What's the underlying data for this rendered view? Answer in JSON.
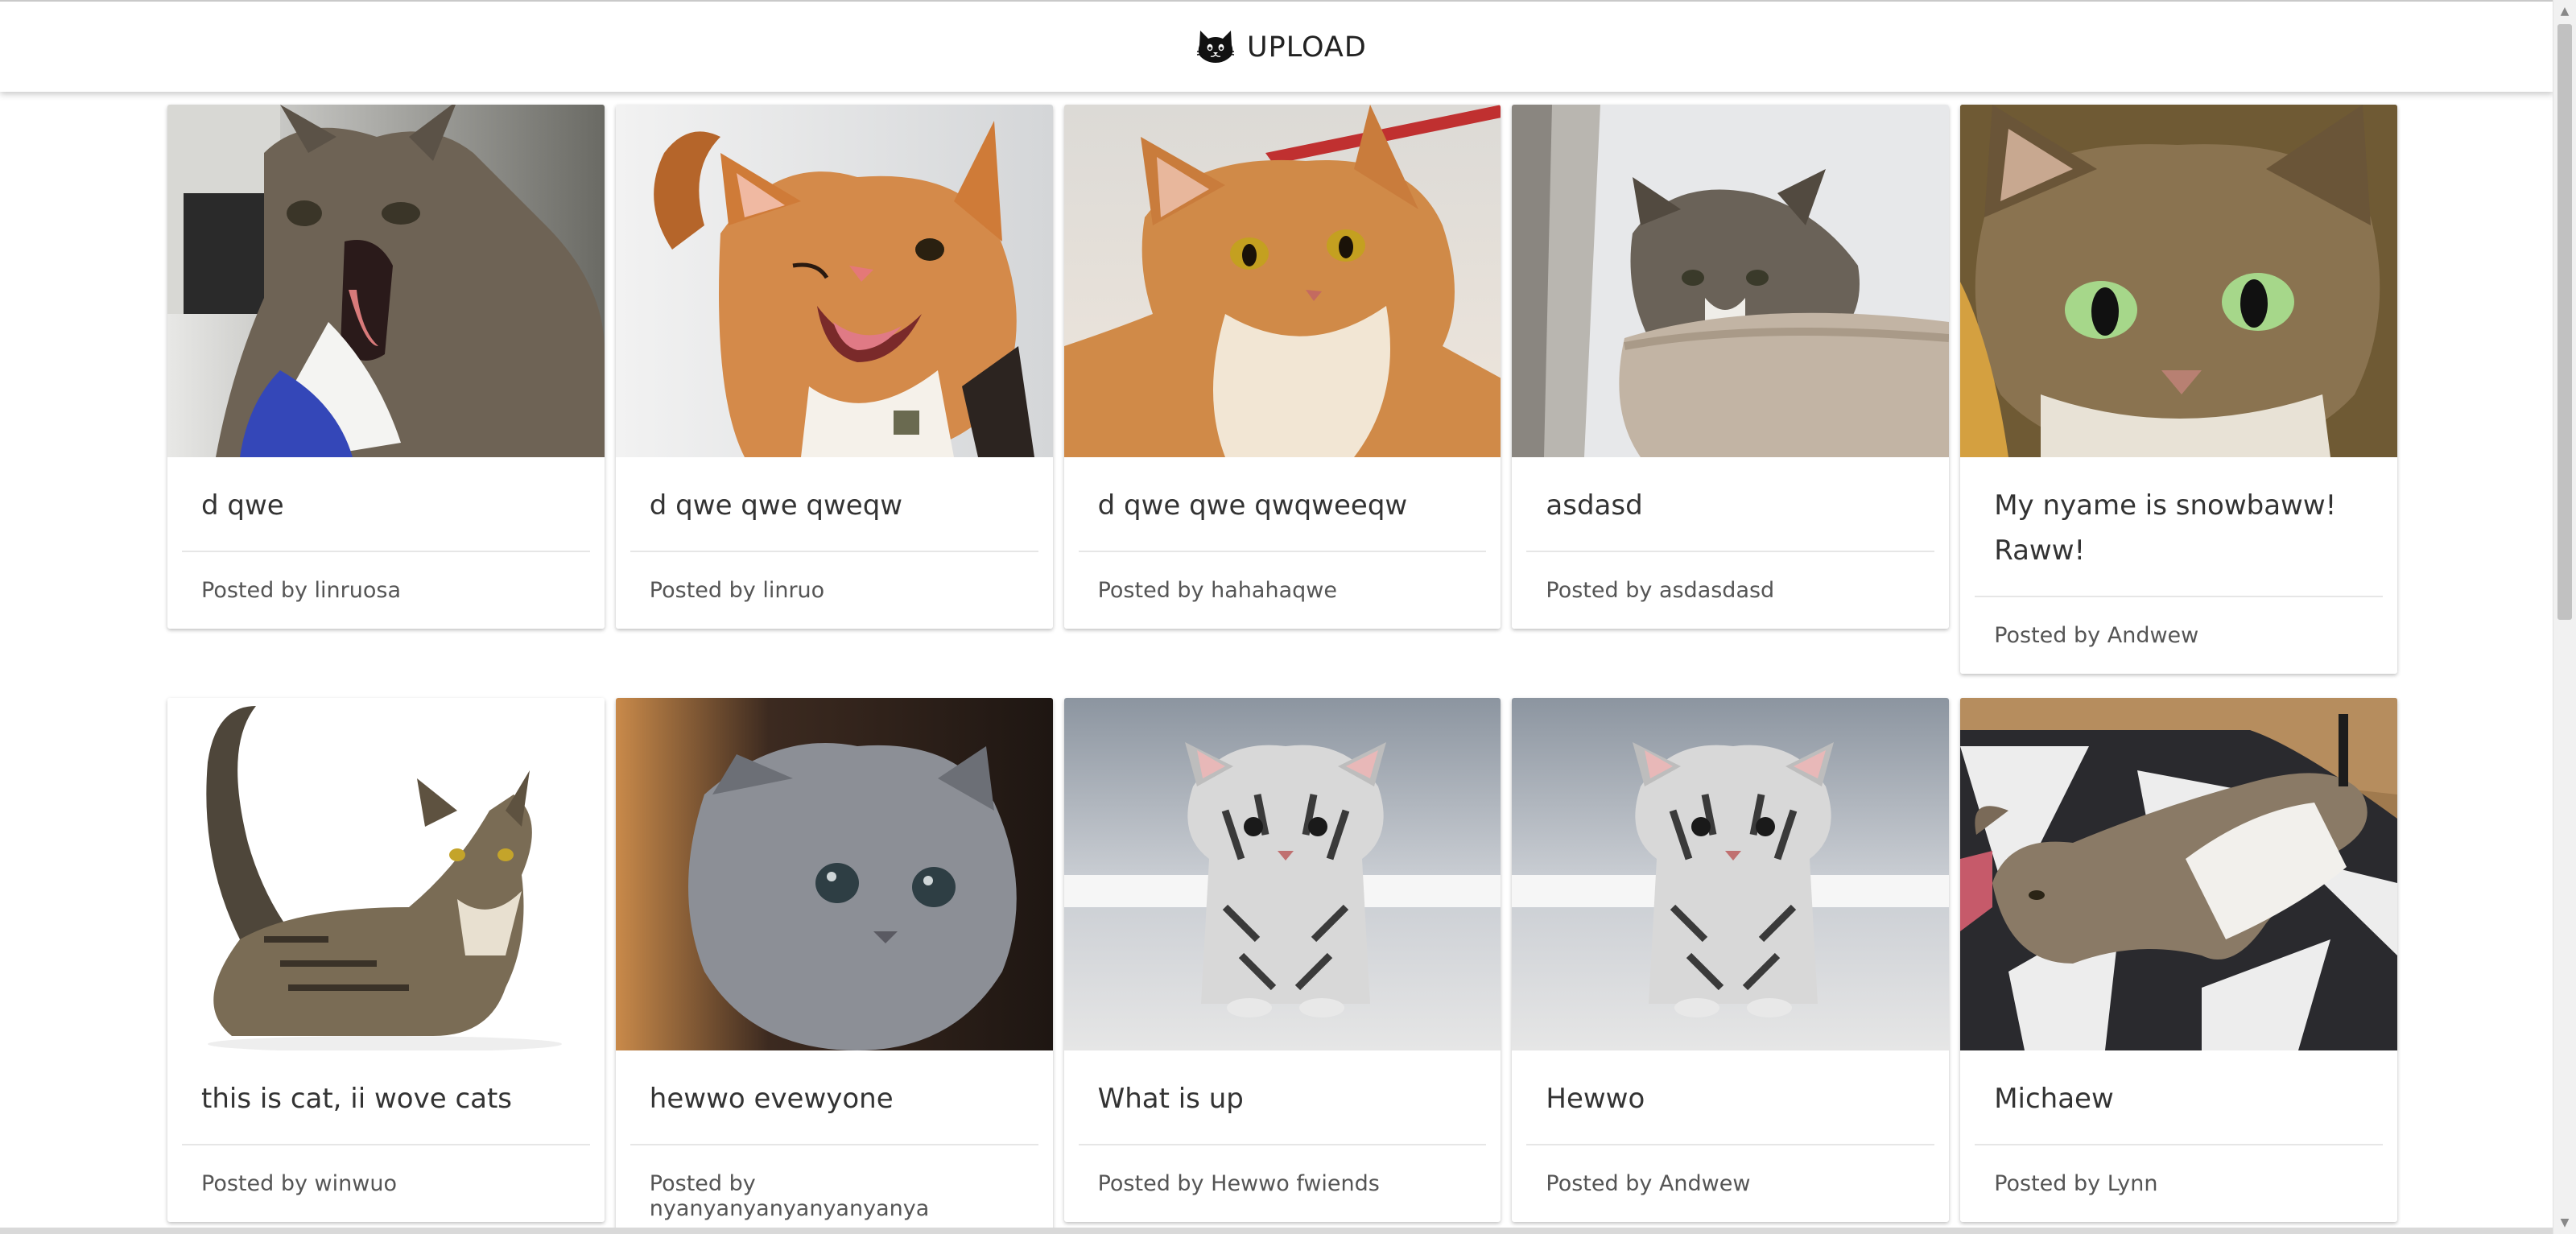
{
  "header": {
    "upload_label": "UPLOAD",
    "icon": "cat-icon"
  },
  "cards": [
    {
      "title": "d qwe",
      "posted_by_prefix": "Posted by",
      "author": "linruosa",
      "image": "yawning-tabby-cat"
    },
    {
      "title": "d qwe qwe qweqw",
      "posted_by_prefix": "Posted by",
      "author": "linruo",
      "image": "winking-orange-cat"
    },
    {
      "title": "d qwe qwe qwqweeqw",
      "posted_by_prefix": "Posted by",
      "author": "hahahaqwe",
      "image": "orange-cat"
    },
    {
      "title": "asdasd",
      "posted_by_prefix": "Posted by",
      "author": "asdasdasd",
      "image": "cat-on-cat-tree"
    },
    {
      "title": "My nyame is snowbaww! Raww!",
      "posted_by_prefix": "Posted by",
      "author": "Andwew",
      "image": "green-eyed-tabby-cat"
    },
    {
      "title": "this is cat, ii wove cats",
      "posted_by_prefix": "Posted by",
      "author": "winwuo",
      "image": "tabby-cat-lying"
    },
    {
      "title": "hewwo evewyone",
      "posted_by_prefix": "Posted by",
      "author": "nyanyanyanyanyanyanya",
      "image": "grey-kitten"
    },
    {
      "title": "What is up",
      "posted_by_prefix": "Posted by",
      "author": "Hewwo fwiends",
      "image": "striped-kitten"
    },
    {
      "title": "Hewwo",
      "posted_by_prefix": "Posted by",
      "author": "Andwew",
      "image": "striped-kitten"
    },
    {
      "title": "Michaew",
      "posted_by_prefix": "Posted by",
      "author": "Lynn",
      "image": "cat-on-rug"
    }
  ]
}
